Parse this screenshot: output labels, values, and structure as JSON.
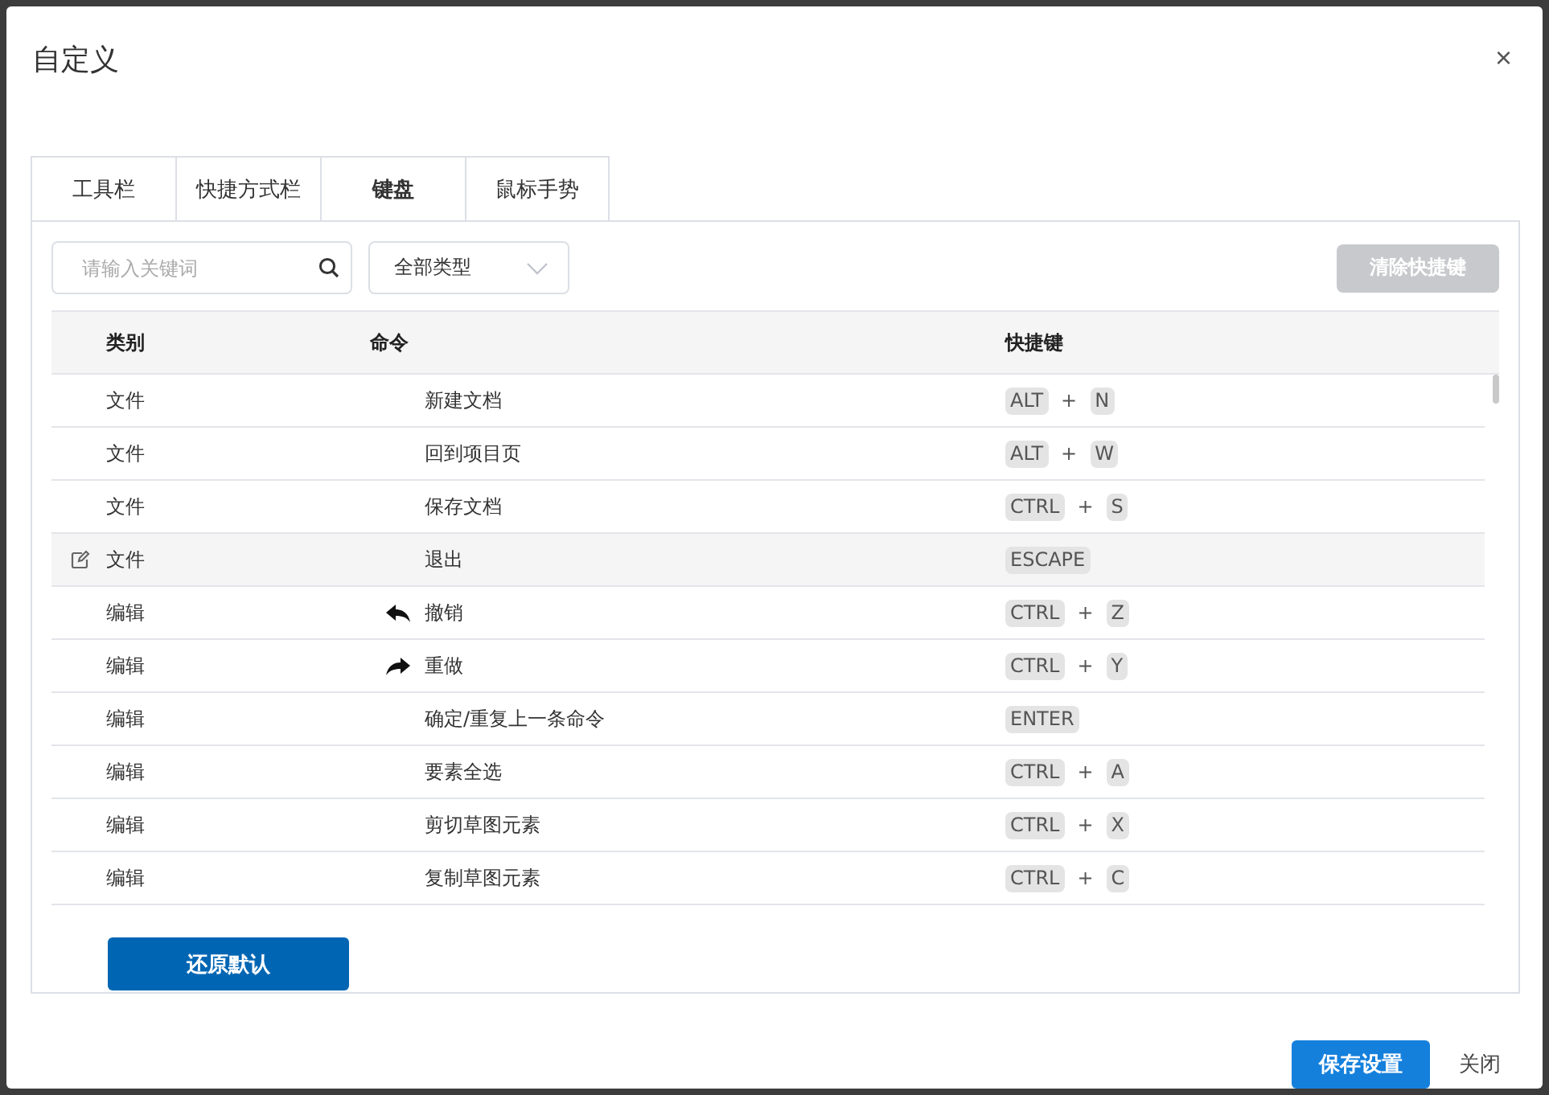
{
  "dialog": {
    "title": "自定义",
    "close": "×"
  },
  "tabs": [
    {
      "label": "工具栏",
      "selected": false
    },
    {
      "label": "快捷方式栏",
      "selected": false
    },
    {
      "label": "键盘",
      "selected": true
    },
    {
      "label": "鼠标手势",
      "selected": false
    }
  ],
  "search": {
    "placeholder": "请输入关键词"
  },
  "type_select": {
    "value": "全部类型"
  },
  "clear_button": {
    "label": "清除快捷键",
    "disabled": true
  },
  "table": {
    "columns": [
      "类别",
      "命令",
      "快捷键"
    ],
    "rows": [
      {
        "category": "文件",
        "command": "新建文档",
        "highlighted": false,
        "shortcut": [
          {
            "kind": "key",
            "text": "ALT"
          },
          {
            "kind": "plus",
            "text": "+"
          },
          {
            "kind": "key",
            "text": "N"
          }
        ]
      },
      {
        "category": "文件",
        "command": "回到项目页",
        "highlighted": false,
        "shortcut": [
          {
            "kind": "key",
            "text": "ALT"
          },
          {
            "kind": "plus",
            "text": "+"
          },
          {
            "kind": "key",
            "text": "W"
          }
        ]
      },
      {
        "category": "文件",
        "command": "保存文档",
        "highlighted": false,
        "shortcut": [
          {
            "kind": "key",
            "text": "CTRL"
          },
          {
            "kind": "plus",
            "text": "+"
          },
          {
            "kind": "key",
            "text": "S"
          }
        ]
      },
      {
        "category": "文件",
        "command": "退出",
        "highlighted": true,
        "shortcut": [
          {
            "kind": "key",
            "text": "ESCAPE"
          }
        ]
      },
      {
        "category": "编辑",
        "command": "撤销",
        "kind": "undo",
        "highlighted": false,
        "shortcut": [
          {
            "kind": "key",
            "text": "CTRL"
          },
          {
            "kind": "plus",
            "text": "+"
          },
          {
            "kind": "key",
            "text": "Z"
          }
        ]
      },
      {
        "category": "编辑",
        "command": "重做",
        "kind": "redo",
        "highlighted": false,
        "shortcut": [
          {
            "kind": "key",
            "text": "CTRL"
          },
          {
            "kind": "plus",
            "text": "+"
          },
          {
            "kind": "key",
            "text": "Y"
          }
        ]
      },
      {
        "category": "编辑",
        "command": "确定/重复上一条命令",
        "highlighted": false,
        "shortcut": [
          {
            "kind": "key",
            "text": "ENTER"
          }
        ]
      },
      {
        "category": "编辑",
        "command": "要素全选",
        "highlighted": false,
        "shortcut": [
          {
            "kind": "key",
            "text": "CTRL"
          },
          {
            "kind": "plus",
            "text": "+"
          },
          {
            "kind": "key",
            "text": "A"
          }
        ]
      },
      {
        "category": "编辑",
        "command": "剪切草图元素",
        "highlighted": false,
        "shortcut": [
          {
            "kind": "key",
            "text": "CTRL"
          },
          {
            "kind": "plus",
            "text": "+"
          },
          {
            "kind": "key",
            "text": "X"
          }
        ]
      },
      {
        "category": "编辑",
        "command": "复制草图元素",
        "highlighted": false,
        "shortcut": [
          {
            "kind": "key",
            "text": "CTRL"
          },
          {
            "kind": "plus",
            "text": "+"
          },
          {
            "kind": "key",
            "text": "C"
          }
        ]
      }
    ]
  },
  "restore_button": "还原默认",
  "footer": {
    "save": "保存设置",
    "close": "关闭"
  }
}
